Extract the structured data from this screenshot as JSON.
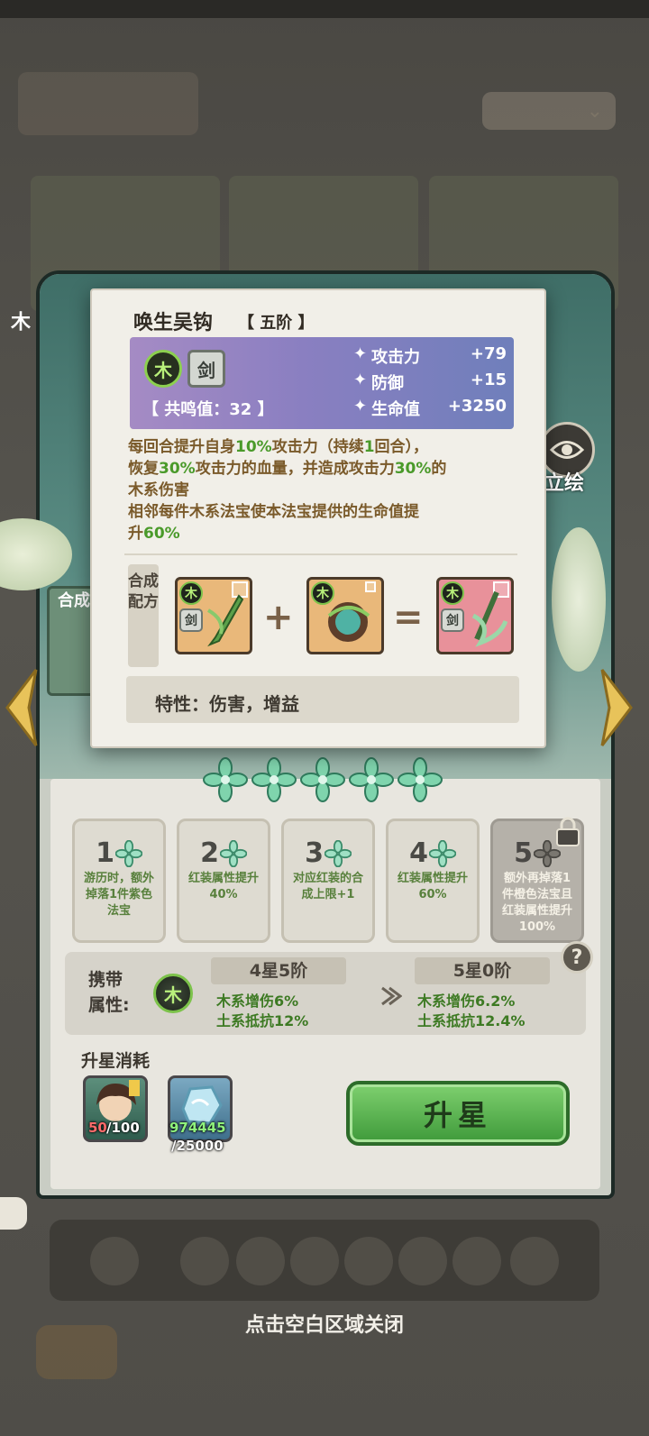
{
  "background": {
    "dropdown_label": "",
    "close_hint": "点击空白区域关闭"
  },
  "hero_panel": {
    "left_vertical_label": "木",
    "mini_card_label": "合成",
    "eye_button_label": "立绘"
  },
  "popup": {
    "name": "唤生吴钩",
    "rank": "【 五阶 】",
    "element_tag": "木",
    "type_tag": "剑",
    "resonance": "【 共鸣值：32 】",
    "stats": [
      {
        "name": "攻击力",
        "value": "+79"
      },
      {
        "name": "防御",
        "value": "+15"
      },
      {
        "name": "生命值",
        "value": "+3250"
      }
    ],
    "skill_lines": [
      [
        "每回合提升自身",
        "10%",
        "攻击力（持续",
        "1",
        "回合），"
      ],
      [
        "恢复",
        "30%",
        "攻击力的血量，并造成攻击力",
        "30%",
        "的"
      ],
      [
        "木系伤害"
      ],
      [
        "相邻每件木系法宝使本法宝提供的生命值提"
      ],
      [
        "升",
        "60%"
      ]
    ],
    "recipe_label": "合成配方",
    "recipe_items": [
      {
        "elem": "木",
        "type": "剑",
        "color": "#e9b87a"
      },
      {
        "elem": "木",
        "type": "",
        "color": "#e9b87a"
      },
      {
        "elem": "木",
        "type": "剑",
        "color": "#e8919a"
      }
    ],
    "recipe_plus": "+",
    "recipe_equals": "=",
    "trait": "特性：伤害，增益"
  },
  "star_tiers": [
    {
      "num": "1",
      "desc": "游历时，额外掉落1件紫色法宝",
      "locked": false
    },
    {
      "num": "2",
      "desc": "红装属性提升40%",
      "locked": false
    },
    {
      "num": "3",
      "desc": "对应红装的合成上限+1",
      "locked": false
    },
    {
      "num": "4",
      "desc": "红装属性提升60%",
      "locked": false
    },
    {
      "num": "5",
      "desc": "额外再掉落1件橙色法宝且红装属性提升100%",
      "locked": true
    }
  ],
  "carry": {
    "label": "携带属性:",
    "element": "木",
    "current": {
      "stage": "4星5阶",
      "lines": [
        "木系增伤6%",
        "土系抵抗12%"
      ]
    },
    "next": {
      "stage": "5星0阶",
      "lines": [
        "木系增伤6.2%",
        "土系抵抗12.4%"
      ]
    },
    "help": "?"
  },
  "cost": {
    "title": "升星消耗",
    "items": [
      {
        "have": "50",
        "need": "/100",
        "kind": "hero-shard"
      },
      {
        "have": "974445",
        "need": "/25000",
        "kind": "jade"
      }
    ],
    "button": "升星"
  },
  "colors": {
    "accent_green": "#4a9a2a",
    "skill_brown": "#7a5a2a",
    "panel_teal": "#3f6e67",
    "button_green": "#3f9a3a"
  }
}
